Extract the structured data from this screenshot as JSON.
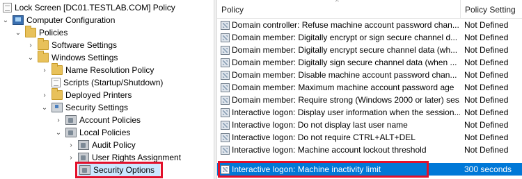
{
  "tree": {
    "items": [
      {
        "label": "Lock Screen [DC01.TESTLAB.COM] Policy",
        "expand": "",
        "icon": "policy-document-icon"
      },
      {
        "label": "Computer Configuration",
        "expand": "expanded",
        "icon": "computer-icon"
      },
      {
        "label": "Policies",
        "expand": "expanded",
        "icon": "folder-icon"
      },
      {
        "label": "Software Settings",
        "expand": "collapsed",
        "icon": "folder-icon"
      },
      {
        "label": "Windows Settings",
        "expand": "expanded",
        "icon": "folder-icon"
      },
      {
        "label": "Name Resolution Policy",
        "expand": "collapsed",
        "icon": "folder-icon"
      },
      {
        "label": "Scripts (Startup/Shutdown)",
        "expand": "",
        "icon": "scripts-document-icon"
      },
      {
        "label": "Deployed Printers",
        "expand": "collapsed",
        "icon": "printers-icon"
      },
      {
        "label": "Security Settings",
        "expand": "expanded",
        "icon": "security-settings-icon"
      },
      {
        "label": "Account Policies",
        "expand": "collapsed",
        "icon": "security-folder-icon"
      },
      {
        "label": "Local Policies",
        "expand": "expanded",
        "icon": "security-folder-icon"
      },
      {
        "label": "Audit Policy",
        "expand": "collapsed",
        "icon": "security-folder-icon"
      },
      {
        "label": "User Rights Assignment",
        "expand": "collapsed",
        "icon": "security-folder-icon"
      },
      {
        "label": "Security Options",
        "expand": "",
        "icon": "security-folder-icon"
      }
    ]
  },
  "list": {
    "columns": {
      "policy": "Policy",
      "setting": "Policy Setting"
    },
    "rows": [
      {
        "policy": "Domain controller: Refuse machine account password chan...",
        "setting": "Not Defined"
      },
      {
        "policy": "Domain member: Digitally encrypt or sign secure channel d...",
        "setting": "Not Defined"
      },
      {
        "policy": "Domain member: Digitally encrypt secure channel data (wh...",
        "setting": "Not Defined"
      },
      {
        "policy": "Domain member: Digitally sign secure channel data (when ...",
        "setting": "Not Defined"
      },
      {
        "policy": "Domain member: Disable machine account password chan...",
        "setting": "Not Defined"
      },
      {
        "policy": "Domain member: Maximum machine account password age",
        "setting": "Not Defined"
      },
      {
        "policy": "Domain member: Require strong (Windows 2000 or later) ses...",
        "setting": "Not Defined"
      },
      {
        "policy": "Interactive logon: Display user information when the session...",
        "setting": "Not Defined"
      },
      {
        "policy": "Interactive logon: Do not display last user name",
        "setting": "Not Defined"
      },
      {
        "policy": "Interactive logon: Do not require CTRL+ALT+DEL",
        "setting": "Not Defined"
      },
      {
        "policy": "Interactive logon: Machine account lockout threshold",
        "setting": "Not Defined"
      },
      {
        "policy": "Interactive logon: Machine inactivity limit",
        "setting": "300 seconds"
      }
    ]
  },
  "colors": {
    "selection": "#0078d7",
    "highlight_box": "#e2102b",
    "tree_selection": "#cce8ff"
  }
}
